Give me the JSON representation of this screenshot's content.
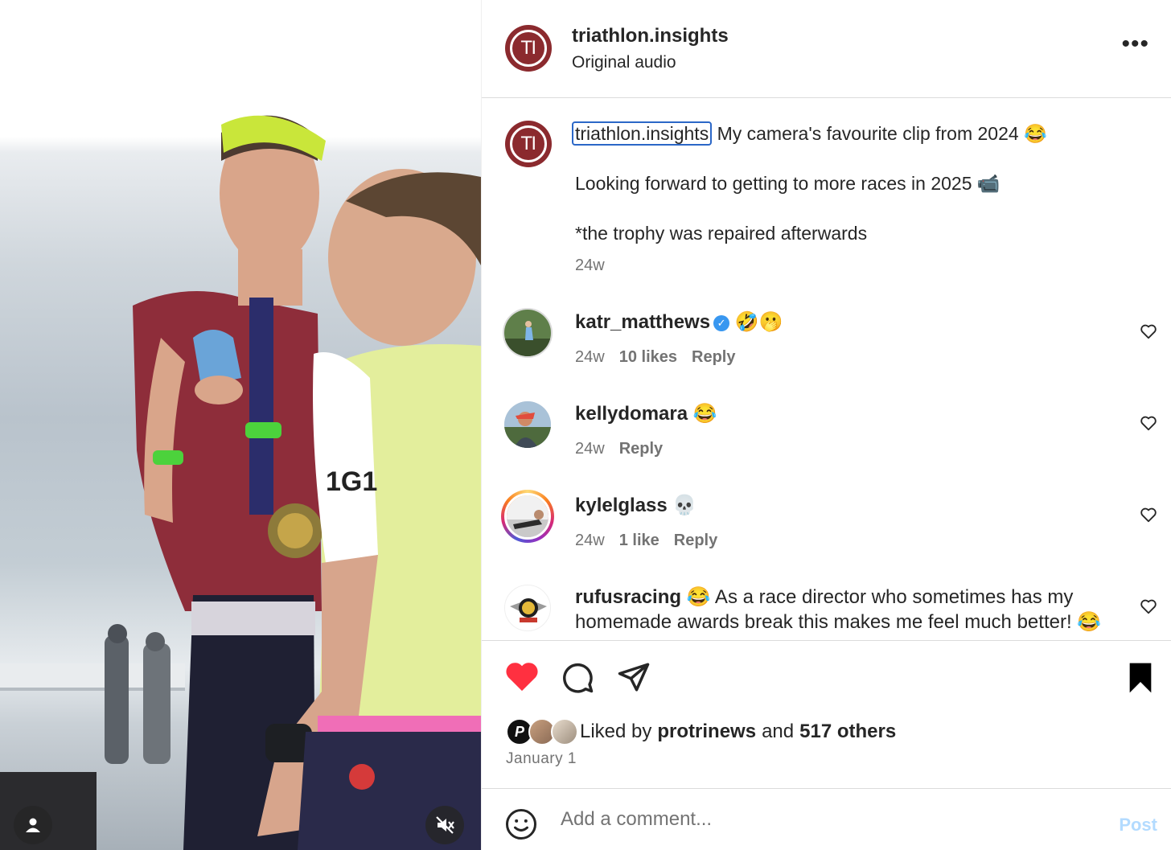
{
  "header": {
    "username": "triathlon.insights",
    "subtitle": "Original audio",
    "logo_text": "TI",
    "more_label": "•••"
  },
  "caption": {
    "username": "triathlon.insights",
    "line1": "My camera's favourite clip from 2024 😂",
    "line2": "Looking forward to getting to more races in 2025 📹",
    "line3": "*the trophy was repaired afterwards",
    "time": "24w"
  },
  "comments": [
    {
      "username": "katr_matthews",
      "verified": true,
      "text": "🤣🫢",
      "time": "24w",
      "likes": "10 likes",
      "reply": "Reply"
    },
    {
      "username": "kellydomara",
      "verified": false,
      "text": "😂",
      "time": "24w",
      "likes": "",
      "reply": "Reply"
    },
    {
      "username": "kylelglass",
      "verified": false,
      "text": "💀",
      "time": "24w",
      "likes": "1 like",
      "reply": "Reply"
    },
    {
      "username": "rufusracing",
      "verified": false,
      "text": "😂 As a race director who sometimes has my homemade awards break this makes me feel much better! 😂"
    }
  ],
  "likes": {
    "prefix": "Liked by",
    "user": "protrinews",
    "and": "and",
    "others": "517 others"
  },
  "date": "January 1",
  "add_comment": {
    "placeholder": "Add a comment...",
    "post_label": "Post"
  },
  "colors": {
    "like_red": "#ff3040",
    "link_blue": "#0095f6",
    "brand": "#8b2a2e"
  },
  "icons": [
    "heart-filled-icon",
    "comment-icon",
    "share-icon",
    "bookmark-filled-icon",
    "emoji-icon",
    "mute-icon",
    "user-tag-icon",
    "more-icon"
  ]
}
